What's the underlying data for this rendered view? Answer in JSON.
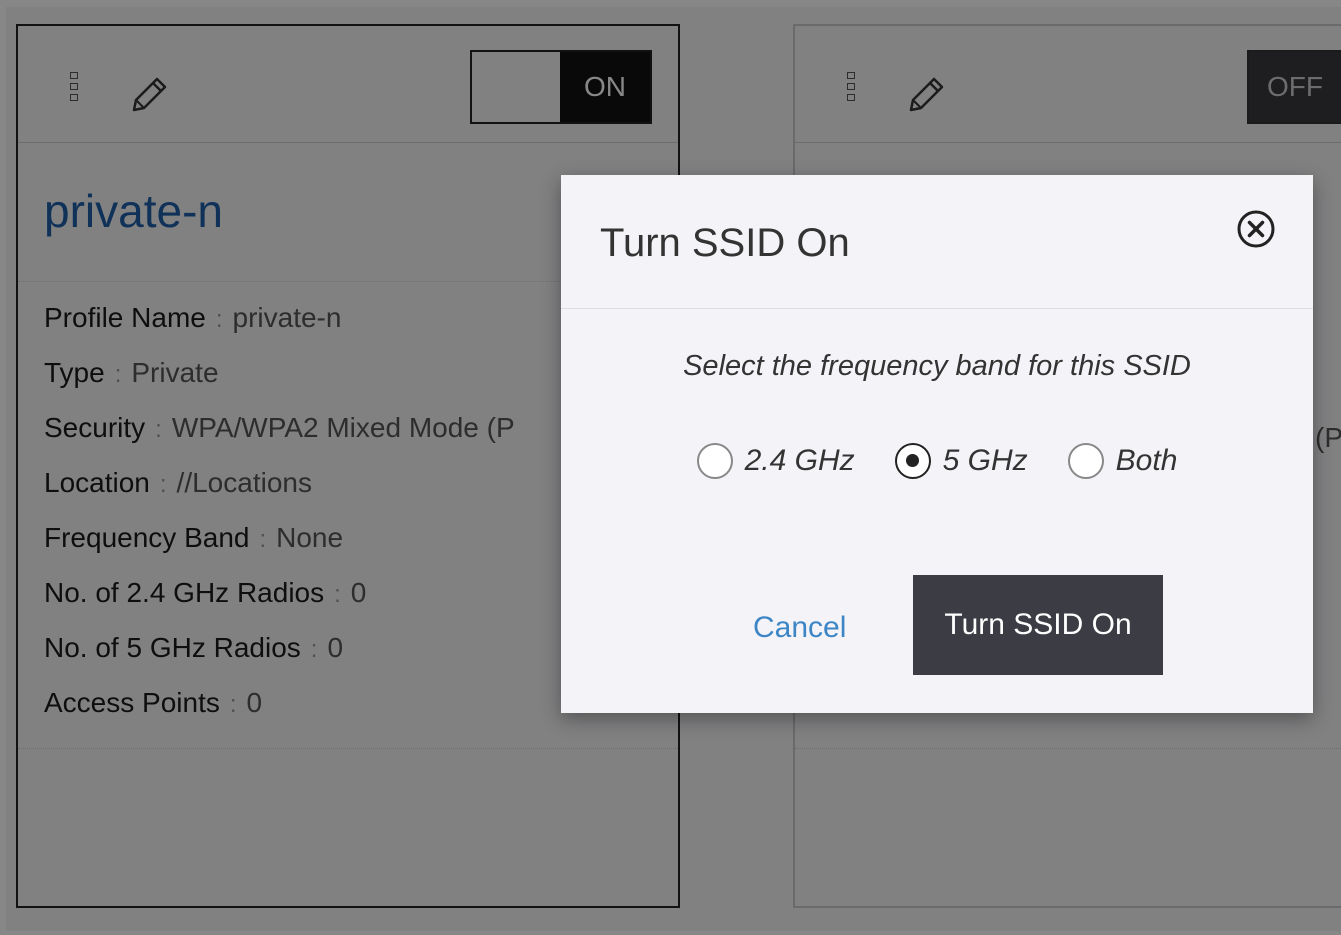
{
  "cards": [
    {
      "toggle_label": "ON",
      "title": "private-n",
      "properties": [
        {
          "key": "Profile Name",
          "value": "private-n"
        },
        {
          "key": "Type",
          "value": "Private"
        },
        {
          "key": "Security",
          "value": "WPA/WPA2 Mixed Mode (P"
        },
        {
          "key": "Location",
          "value": "//Locations"
        },
        {
          "key": "Frequency Band",
          "value": "None"
        },
        {
          "key": "No. of 2.4 GHz Radios",
          "value": "0"
        },
        {
          "key": "No. of 5 GHz Radios",
          "value": "0"
        },
        {
          "key": "Access Points",
          "value": "0"
        }
      ]
    },
    {
      "toggle_label": "OFF",
      "partial_security": "(P"
    }
  ],
  "dialog": {
    "title": "Turn SSID On",
    "prompt": "Select the frequency band for this SSID",
    "options": [
      {
        "label": "2.4 GHz",
        "selected": false
      },
      {
        "label": "5 GHz",
        "selected": true
      },
      {
        "label": "Both",
        "selected": false
      }
    ],
    "cancel_label": "Cancel",
    "confirm_label": "Turn SSID On"
  },
  "colors": {
    "title_blue": "#1f5fa8",
    "link_blue": "#3d86c6",
    "primary_button": "#3b3c44"
  },
  "icons": [
    "drag-handle-icon",
    "pencil-icon",
    "close-circle-icon"
  ]
}
